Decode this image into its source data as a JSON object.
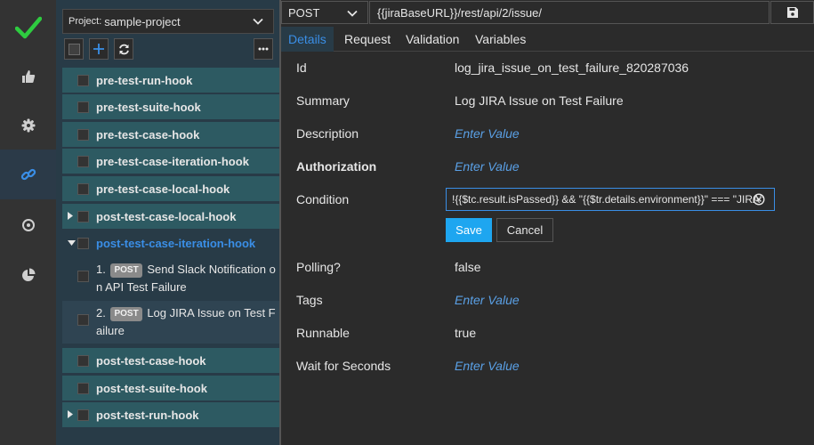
{
  "project": {
    "prefix": "Project:",
    "name": "sample-project"
  },
  "tree": {
    "rows": [
      {
        "label": "pre-test-run-hook"
      },
      {
        "label": "pre-test-suite-hook"
      },
      {
        "label": "pre-test-case-hook"
      },
      {
        "label": "pre-test-case-iteration-hook"
      },
      {
        "label": "pre-test-case-local-hook"
      },
      {
        "label": "post-test-case-local-hook"
      },
      {
        "label": "post-test-case-iteration-hook"
      },
      {
        "label": "post-test-case-hook"
      },
      {
        "label": "post-test-suite-hook"
      },
      {
        "label": "post-test-run-hook"
      }
    ],
    "children": [
      {
        "index": "1.",
        "badge": "POST",
        "title": "Send Slack Notification o n API Test Failure"
      },
      {
        "index": "2.",
        "badge": "POST",
        "title": "Log JIRA Issue on Test F ailure"
      }
    ]
  },
  "request": {
    "method": "POST",
    "url": "{{jiraBaseURL}}/rest/api/2/issue/"
  },
  "tabs": [
    "Details",
    "Request",
    "Validation",
    "Variables"
  ],
  "fields": {
    "id": {
      "label": "Id",
      "value": "log_jira_issue_on_test_failure_820287036"
    },
    "summary": {
      "label": "Summary",
      "value": "Log JIRA Issue on Test Failure"
    },
    "description": {
      "label": "Description",
      "value": "Enter Value"
    },
    "authorization": {
      "label": "Authorization",
      "value": "Enter Value"
    },
    "condition": {
      "label": "Condition",
      "value": "!{{$tc.result.isPassed}} && \"{{$tr.details.environment}}\" === \"JIRA\""
    },
    "polling": {
      "label": "Polling?",
      "value": "false"
    },
    "tags": {
      "label": "Tags",
      "value": "Enter Value"
    },
    "runnable": {
      "label": "Runnable",
      "value": "true"
    },
    "wait": {
      "label": "Wait for Seconds",
      "value": "Enter Value"
    }
  },
  "buttons": {
    "save": "Save",
    "cancel": "Cancel"
  },
  "colors": {
    "accent": "#3a8ee6",
    "success": "#2ecc40",
    "save_button": "#1ea6f0",
    "row": "#2d5a62"
  }
}
